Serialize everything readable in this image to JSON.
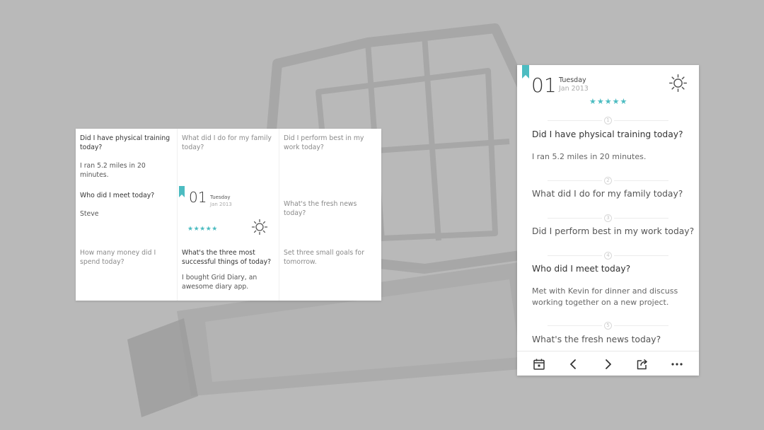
{
  "grid_card": {
    "cells": [
      {
        "question": "Did I have physical training today?",
        "answer": "I ran 5.2 miles in 20 minutes."
      },
      {
        "question": "What did I do for my family today?"
      },
      {
        "question": "Did I perform best in my work today?"
      },
      {
        "question": "Who did I meet today?",
        "answer": "Steve"
      },
      {
        "question": "What's the fresh news today?"
      },
      {
        "question": "How many money did I spend today?"
      },
      {
        "question": "What's the three most successful things of today?",
        "answer": "I bought Grid Diary, an awesome diary app."
      },
      {
        "question": "Set three small goals for tomorrow."
      }
    ],
    "date": {
      "day": "01",
      "weekday": "Tuesday",
      "month": "Jan 2013"
    },
    "rating": "★★★★★",
    "weather_icon": "sun-icon"
  },
  "phone_card": {
    "date": {
      "day": "01",
      "weekday": "Tuesday",
      "month": "Jan 2013"
    },
    "rating": "★★★★★",
    "weather_icon": "sun-icon",
    "entries": [
      {
        "number": "1",
        "question": "Did I have physical training today?",
        "answer": "I ran 5.2 miles in 20 minutes."
      },
      {
        "number": "2",
        "question": "What did I do for my family today?"
      },
      {
        "number": "3",
        "question": "Did I perform best in my work today?"
      },
      {
        "number": "4",
        "question": "Who did I meet today?",
        "answer": "Met with Kevin for dinner and discuss working together on a new project."
      },
      {
        "number": "5",
        "question": "What's the fresh news today?"
      }
    ],
    "toolbar": [
      "calendar-icon",
      "chevron-left-icon",
      "chevron-right-icon",
      "share-icon",
      "more-icon"
    ]
  },
  "colors": {
    "accent": "#4cbcc1",
    "background": "#b9b9b9",
    "card": "#ffffff"
  }
}
